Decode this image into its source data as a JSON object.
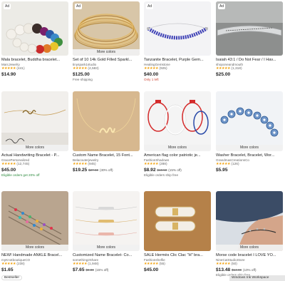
{
  "ad_label": "Ad",
  "more_colors_label": "More colors",
  "bestseller_label": "Bestseller",
  "toast_text": "Windows Ink Workspace",
  "colors": {
    "star": "#f1a10d",
    "green_text": "#2c8a3d",
    "red_text": "#c43333"
  },
  "cards": [
    {
      "title": "Mala bracelet, Buddha bracelet...",
      "shop": "MarcJewelry",
      "stars": "★★★★★",
      "reviews": "(441)",
      "price": "$14.90",
      "was": "",
      "off": "",
      "sub": "",
      "ad": true,
      "more": false
    },
    {
      "title": "Set of 10 14k Gold Filled Sparkl...",
      "shop": "tinyspark1studio",
      "stars": "★★★★★",
      "reviews": "(4,583)",
      "price": "$125.00",
      "was": "",
      "off": "",
      "sub": "Free shipping",
      "ad": true,
      "more": true
    },
    {
      "title": "Tanzanite Bracelet, Purple Gem...",
      "shop": "HealingGemstone",
      "stars": "★★★★★",
      "reviews": "(925)",
      "price": "$40.00",
      "was": "",
      "off": "",
      "sub": "Only 1 left",
      "ad": true,
      "more": false
    },
    {
      "title": "Isaiah 43:1 / Do Not Fear / I Hav...",
      "shop": "shoponeandmouth",
      "stars": "★★★★★",
      "reviews": "(1,318)",
      "price": "$25.00",
      "was": "",
      "off": "",
      "sub": "",
      "ad": true,
      "more": false
    },
    {
      "title": "Actual Handwriting Bracelet - P...",
      "shop": "GracePersonalized",
      "stars": "★★★★★",
      "reviews": "(12,745)",
      "price": "$45.00",
      "was": "",
      "off": "",
      "sub": "Eligible orders get 20% off",
      "ad": false,
      "more": true
    },
    {
      "title": "Custom Name Bracelet, 15 Font...",
      "shop": "Belacouterjewelry",
      "stars": "★★★★★",
      "reviews": "(945)",
      "price": "$19.25",
      "was": "$27.50",
      "off": "(30% off)",
      "sub": "",
      "ad": false,
      "more": false
    },
    {
      "title": "American flag color patriotic je...",
      "shop": "FashionShadows",
      "stars": "★★★★★",
      "reviews": "(288)",
      "price": "$8.92",
      "was": "$10.50",
      "off": "(15% off)",
      "sub": "Eligible orders ship free",
      "ad": false,
      "more": true
    },
    {
      "title": "Washer Bracelet, Bracelet, Wor...",
      "shop": "GrandmasCreationsCo",
      "stars": "★★★★★",
      "reviews": "(126)",
      "price": "$5.95",
      "was": "",
      "off": "",
      "sub": "",
      "ad": false,
      "more": true
    },
    {
      "title": "NEW! Handmade ANKLE Bracel...",
      "shop": "myKnotboutiqueCO",
      "stars": "★★★★★",
      "reviews": "(238)",
      "price": "$1.65",
      "was": "",
      "off": "",
      "sub": "",
      "ad": false,
      "more": true
    },
    {
      "title": "Customized Name Bracelet- Co...",
      "shop": "something2Share",
      "stars": "★★★★★",
      "reviews": "(1,948)",
      "price": "$7.65",
      "was": "$9.00",
      "off": "(15% off)",
      "sub": "",
      "ad": false,
      "more": true
    },
    {
      "title": "SALE Hermès Clic Clac \"H\" bra...",
      "shop": "Fashionshelfie",
      "stars": "★★★★★",
      "reviews": "(55)",
      "price": "$45.00",
      "was": "",
      "off": "",
      "sub": "",
      "ad": false,
      "more": false
    },
    {
      "title": "Morse code bracelet I LOVE YO...",
      "shop": "NineCatStudioStore",
      "stars": "★★★★★",
      "reviews": "(50)",
      "price": "$13.48",
      "was": "$14.98",
      "off": "(10% off)",
      "sub": "Eligible orders ship free",
      "ad": false,
      "more": true
    }
  ]
}
